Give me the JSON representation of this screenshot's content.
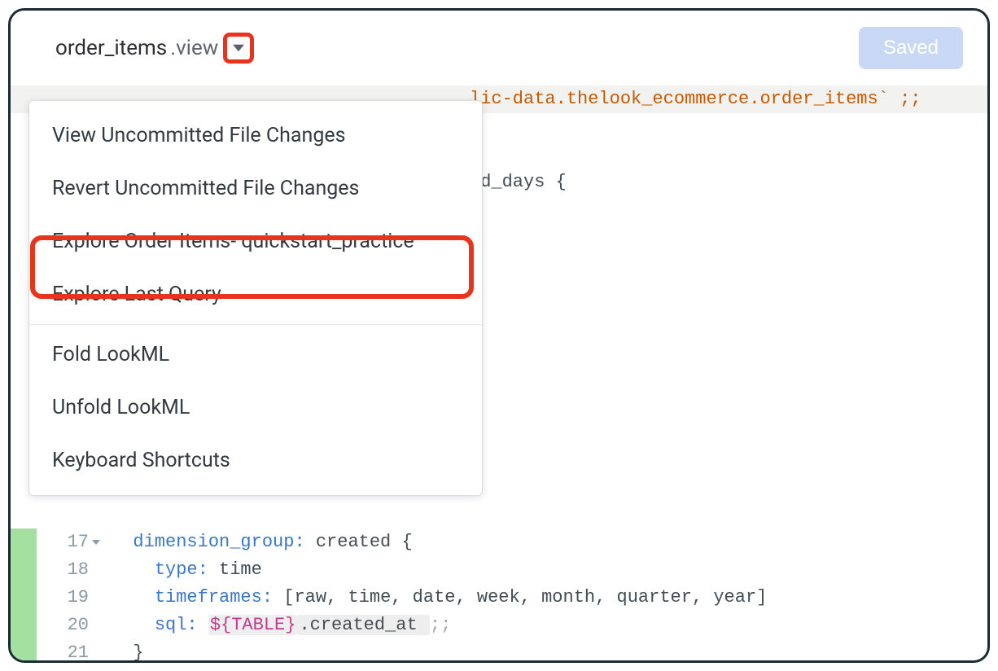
{
  "header": {
    "title_main": "order_items",
    "title_ext": ".view",
    "saved_label": "Saved"
  },
  "menu": {
    "items": [
      "View Uncommitted File Changes",
      "Revert Uncommitted File Changes",
      "Explore Order Items- quickstart_practice",
      "Explore Last Query",
      "Fold LookML",
      "Unfold LookML",
      "Keyboard Shortcuts"
    ]
  },
  "code": {
    "line2_partial": "lic-data.thelook_ecommerce.order_items` ;;",
    "line4_partial": "ed_days {",
    "line7_partial": ";",
    "line8_partial": ";",
    "lines": {
      "17": {
        "kw": "dimension_group:",
        "name": "created",
        "brace": " {"
      },
      "18": {
        "kw": "type:",
        "val": " time"
      },
      "19": {
        "kw": "timeframes:",
        "val": " [raw, time, date, week, month, quarter, year]"
      },
      "20": {
        "kw": "sql:",
        "macro": "${TABLE}",
        "rest": ".created_at ",
        "end": ";;"
      },
      "21": {
        "brace": "}"
      }
    }
  }
}
